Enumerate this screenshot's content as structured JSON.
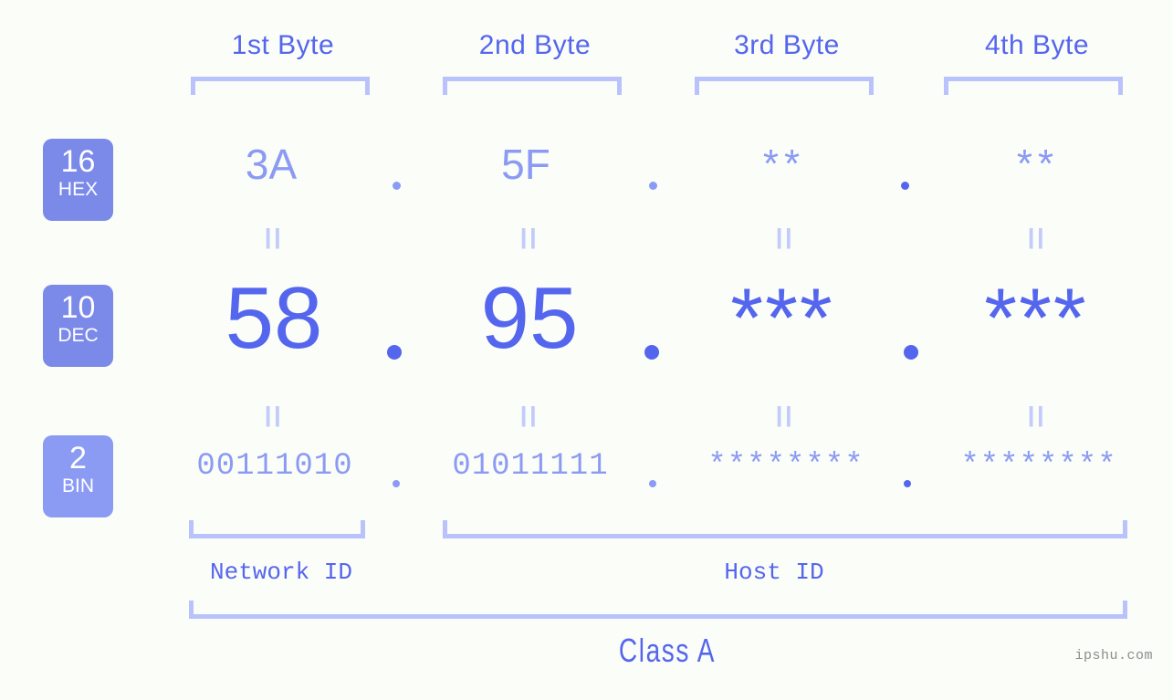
{
  "background_color": "#fbfdf8",
  "colors": {
    "accent_strong": "#5566ee",
    "accent_light": "#8b9bf3",
    "bracket": "#b9c2fb",
    "eq_mark": "#c3cbfb",
    "badge_fill": "#7b8ae8",
    "badge_fill_light": "#8b9bf3",
    "watermark": "#8d8d8d"
  },
  "byte_headers": [
    {
      "label": "1st Byte"
    },
    {
      "label": "2nd Byte"
    },
    {
      "label": "3rd Byte"
    },
    {
      "label": "4th Byte"
    }
  ],
  "bases": [
    {
      "number": "16",
      "name": "HEX"
    },
    {
      "number": "10",
      "name": "DEC"
    },
    {
      "number": "2",
      "name": "BIN"
    }
  ],
  "rows": {
    "hex": {
      "base_number": "16",
      "base_name": "HEX",
      "values": [
        "3A",
        "5F",
        "**",
        "**"
      ],
      "separator": "."
    },
    "dec": {
      "base_number": "10",
      "base_name": "DEC",
      "values": [
        "58",
        "95",
        "***",
        "***"
      ],
      "separator": "."
    },
    "bin": {
      "base_number": "2",
      "base_name": "BIN",
      "values": [
        "00111010",
        "01011111",
        "********",
        "********"
      ],
      "separator": "."
    }
  },
  "equality_mark": "II",
  "sections": [
    {
      "label": "Network ID"
    },
    {
      "label": "Host ID"
    }
  ],
  "class": {
    "label": "Class A"
  },
  "watermark": {
    "text": "ipshu.com"
  }
}
